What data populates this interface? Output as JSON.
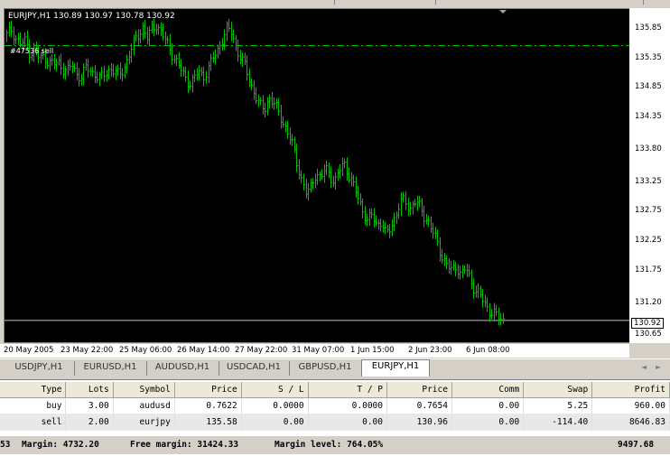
{
  "chart": {
    "title": "EURJPY,H1  130.89 130.97 130.78 130.92",
    "order_label": "#47536 sell",
    "current_price": "130.92",
    "order_price": 135.58,
    "price_min": 130.55,
    "price_max": 136.2,
    "price_ticks": [
      "135.85",
      "135.35",
      "134.85",
      "134.35",
      "133.80",
      "133.25",
      "132.75",
      "132.25",
      "131.75",
      "131.20",
      "130.65"
    ],
    "price_tick_values": [
      135.85,
      135.35,
      134.85,
      134.35,
      133.8,
      133.25,
      132.75,
      132.25,
      131.75,
      131.2,
      130.65
    ],
    "time_ticks": [
      "20 May 2005",
      "23 May 22:00",
      "25 May 06:00",
      "26 May 14:00",
      "27 May 22:00",
      "31 May 07:00",
      "1 Jun 15:00",
      "2 Jun 23:00",
      "6 Jun 08:00"
    ],
    "colors": {
      "bars": "#00c000",
      "background": "#000000",
      "order_line": "#00c000"
    },
    "close_series": [
      135.75,
      135.85,
      135.7,
      135.6,
      135.65,
      135.45,
      135.5,
      135.35,
      135.4,
      135.3,
      135.25,
      135.3,
      135.2,
      135.15,
      135.25,
      135.1,
      135.05,
      135.2,
      135.15,
      135.1,
      135.0,
      135.1,
      135.2,
      135.15,
      135.05,
      135.2,
      135.4,
      135.6,
      135.75,
      135.9,
      135.7,
      135.85,
      135.95,
      135.8,
      135.65,
      135.5,
      135.35,
      135.2,
      135.05,
      134.95,
      135.0,
      135.15,
      135.05,
      135.2,
      135.35,
      135.5,
      135.7,
      135.85,
      135.8,
      135.55,
      135.35,
      135.2,
      134.95,
      134.75,
      134.55,
      134.5,
      134.7,
      134.6,
      134.45,
      134.3,
      134.1,
      133.9,
      133.6,
      133.3,
      133.05,
      133.2,
      133.45,
      133.3,
      133.5,
      133.4,
      133.25,
      133.45,
      133.6,
      133.4,
      133.2,
      133.0,
      132.8,
      132.6,
      132.7,
      132.55,
      132.6,
      132.35,
      132.5,
      132.7,
      132.9,
      132.95,
      132.8,
      132.95,
      132.85,
      132.7,
      132.6,
      132.4,
      132.2,
      132.0,
      131.85,
      131.75,
      131.85,
      131.7,
      131.8,
      131.6,
      131.45,
      131.35,
      131.2,
      131.1,
      131.05,
      130.95,
      130.92
    ]
  },
  "tabs": [
    "USDJPY,H1",
    "EURUSD,H1",
    "AUDUSD,H1",
    "USDCAD,H1",
    "GBPUSD,H1",
    "EURJPY,H1"
  ],
  "active_tab": "EURJPY,H1",
  "nav": {
    "left": "◄",
    "right": "►"
  },
  "terminal": {
    "headers": [
      "Type",
      "Lots",
      "Symbol",
      "Price",
      "S / L",
      "T / P",
      "Price",
      "Comm",
      "Swap",
      "Profit"
    ],
    "rows": [
      [
        "buy",
        "3.00",
        "audusd",
        "0.7622",
        "0.0000",
        "0.0000",
        "0.7654",
        "0.00",
        "5.25",
        "960.00"
      ],
      [
        "sell",
        "2.00",
        "eurjpy",
        "135.58",
        "0.00",
        "0.00",
        "130.96",
        "0.00",
        "-114.40",
        "8646.83"
      ]
    ],
    "balance_prefix": "53",
    "margin": "Margin: 4732.20",
    "free_margin": "Free margin: 31424.33",
    "margin_level": "Margin level: 764.05%",
    "total_profit": "9497.68"
  }
}
